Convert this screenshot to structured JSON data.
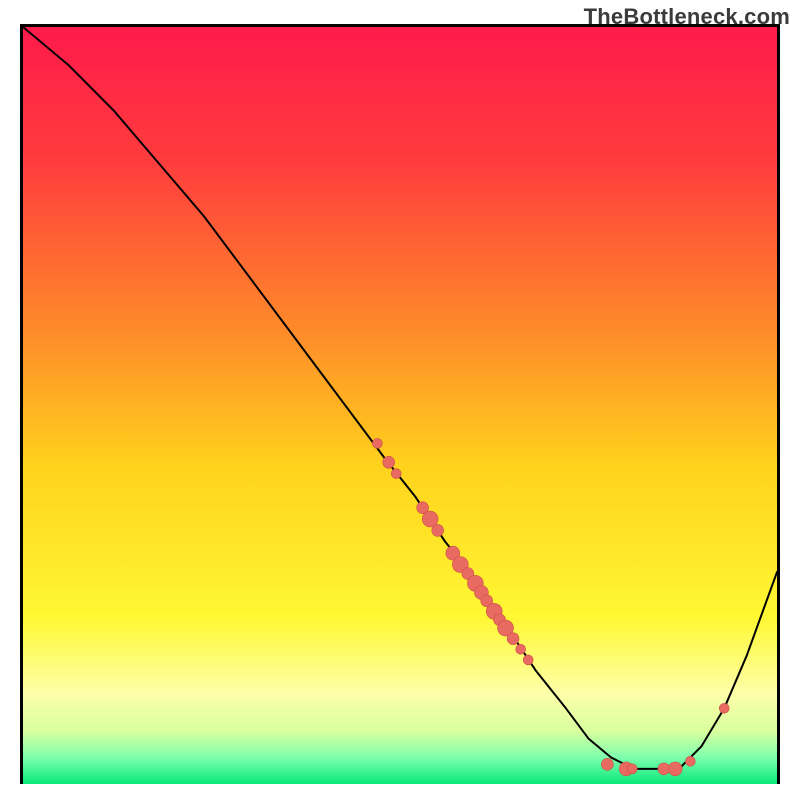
{
  "watermark": "TheBottleneck.com",
  "colors": {
    "marker_fill": "#e96a60",
    "marker_stroke": "#c95048",
    "curve": "#000000"
  },
  "chart_data": {
    "type": "line",
    "title": "",
    "xlabel": "",
    "ylabel": "",
    "xlim": [
      0,
      100
    ],
    "ylim": [
      0,
      100
    ],
    "x": [
      0,
      6,
      12,
      18,
      24,
      30,
      36,
      42,
      48,
      52,
      56,
      60,
      64,
      68,
      72,
      75,
      78,
      81,
      84,
      87,
      90,
      93,
      96,
      100
    ],
    "values": [
      100,
      95,
      89,
      82,
      75,
      67,
      59,
      51,
      43,
      38,
      32,
      27,
      21,
      15,
      10,
      6,
      3.5,
      2,
      2,
      2,
      5,
      10,
      17,
      28
    ],
    "markers": [
      {
        "x": 47.0,
        "y": 45.0,
        "r": 5
      },
      {
        "x": 48.5,
        "y": 42.5,
        "r": 6
      },
      {
        "x": 49.5,
        "y": 41.0,
        "r": 5
      },
      {
        "x": 53.0,
        "y": 36.5,
        "r": 6
      },
      {
        "x": 54.0,
        "y": 35.0,
        "r": 8
      },
      {
        "x": 55.0,
        "y": 33.5,
        "r": 6
      },
      {
        "x": 57.0,
        "y": 30.5,
        "r": 7
      },
      {
        "x": 58.0,
        "y": 29.0,
        "r": 8
      },
      {
        "x": 59.0,
        "y": 27.8,
        "r": 6
      },
      {
        "x": 60.0,
        "y": 26.5,
        "r": 8
      },
      {
        "x": 60.8,
        "y": 25.3,
        "r": 7
      },
      {
        "x": 61.5,
        "y": 24.2,
        "r": 6
      },
      {
        "x": 62.5,
        "y": 22.8,
        "r": 8
      },
      {
        "x": 63.2,
        "y": 21.7,
        "r": 6
      },
      {
        "x": 64.0,
        "y": 20.6,
        "r": 8
      },
      {
        "x": 65.0,
        "y": 19.2,
        "r": 6
      },
      {
        "x": 66.0,
        "y": 17.8,
        "r": 5
      },
      {
        "x": 67.0,
        "y": 16.4,
        "r": 5
      },
      {
        "x": 77.5,
        "y": 2.6,
        "r": 6
      },
      {
        "x": 80.0,
        "y": 2.0,
        "r": 7
      },
      {
        "x": 80.8,
        "y": 2.0,
        "r": 5
      },
      {
        "x": 85.0,
        "y": 2.0,
        "r": 6
      },
      {
        "x": 86.5,
        "y": 2.0,
        "r": 7
      },
      {
        "x": 88.5,
        "y": 3.0,
        "r": 5
      },
      {
        "x": 93.0,
        "y": 10.0,
        "r": 5
      }
    ]
  }
}
